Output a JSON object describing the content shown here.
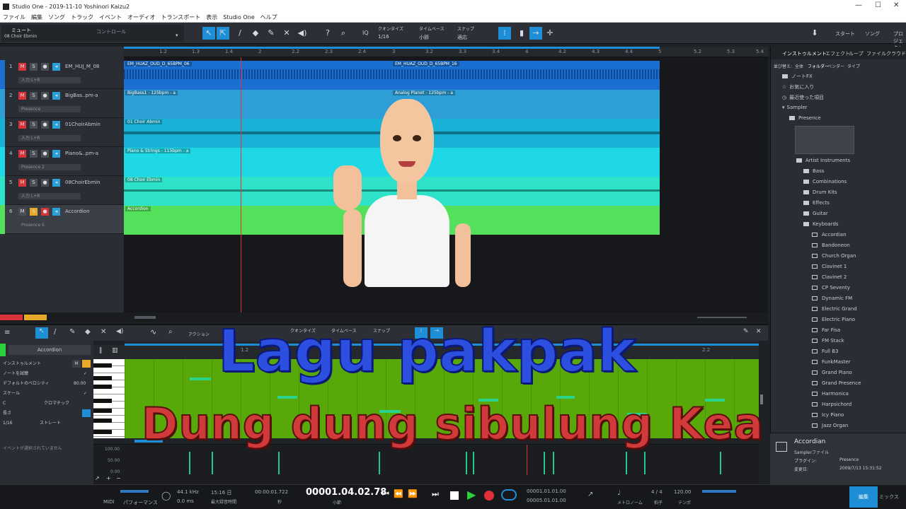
{
  "window": {
    "title": "Studio One - 2019-11-10 Yoshinori Kaizu2"
  },
  "menu": [
    "ファイル",
    "編集",
    "ソング",
    "トラック",
    "イベント",
    "オーディオ",
    "トランスポート",
    "表示",
    "Studio One",
    "ヘルプ"
  ],
  "toolbar": {
    "mute_label": "ミュート",
    "track_label": "08 Choir Ebmin",
    "control_label": "コントロール",
    "quantize_label": "クオンタイズ",
    "quantize_value": "1/16",
    "timebase_label": "タイムベース",
    "timebase_value": "小節",
    "snap_label": "スナップ",
    "snap_value": "適応",
    "iq": "IQ",
    "start_label": "スタート",
    "song_label": "ソング",
    "project_label": "プロジェクト"
  },
  "ruler_ticks": [
    "1.2",
    "1.3",
    "1.4",
    "2",
    "2.2",
    "2.3",
    "2.4",
    "3",
    "3.2",
    "3.3",
    "3.4",
    "4",
    "4.2",
    "4.3",
    "4.4",
    "5",
    "5.2",
    "5.3",
    "5.4"
  ],
  "tracks": [
    {
      "num": "1",
      "name": "EM_HUJ_M_08",
      "sub": "入力 L+R",
      "color": "#1a6fd0",
      "clip_a": "EM_HUAZ_OUD_D_65BPM_06",
      "clip_b": "EM_HUAZ_OUD_D_65BPM_16"
    },
    {
      "num": "2",
      "name": "BigBas..pm-a",
      "sub": "Presence",
      "color": "#2d9ed6",
      "clip_a": "BigBass1 - 125bpm - a",
      "clip_b": "Analog Planet - 125bpm - a"
    },
    {
      "num": "3",
      "name": "01ChoirAbmin",
      "sub": "入力 L+R",
      "color": "#19b2d6",
      "clip_a": "01 Choir Abmin",
      "clip_b": ""
    },
    {
      "num": "4",
      "name": "Piano&..pm-a",
      "sub": "Presence 2",
      "color": "#1fd8e6",
      "clip_a": "Piano & Strings - 115bpm - a",
      "clip_b": ""
    },
    {
      "num": "5",
      "name": "08ChoirEbmin",
      "sub": "入力 L+R",
      "color": "#2de2c8",
      "clip_a": "08 Choir Ebmin",
      "clip_b": ""
    },
    {
      "num": "6",
      "name": "Accordion",
      "sub": "Presence 6",
      "color": "#53e05a",
      "clip_a": "Accordion",
      "clip_b": ""
    }
  ],
  "browser": {
    "tabs": [
      "インストゥルメント",
      "エフェクト",
      "ループ",
      "ファイル",
      "クラウド"
    ],
    "subtabs": [
      "並び替え:",
      "全体",
      "フォルダー",
      "ベンダー",
      "タイプ"
    ],
    "items": [
      {
        "label": "ノートFX",
        "level": 1
      },
      {
        "label": "お気に入り",
        "level": 1
      },
      {
        "label": "最近使った項目",
        "level": 1
      },
      {
        "label": "Sampler",
        "level": 1
      },
      {
        "label": "Presence",
        "level": 2
      },
      {
        "label": "Artist Instruments",
        "level": 3
      },
      {
        "label": "Bass",
        "level": 4
      },
      {
        "label": "Combinations",
        "level": 4
      },
      {
        "label": "Drum Kits",
        "level": 4
      },
      {
        "label": "Effects",
        "level": 4
      },
      {
        "label": "Guitar",
        "level": 4
      },
      {
        "label": "Keyboards",
        "level": 4
      }
    ],
    "presets": [
      "Accordian",
      "Bandoneon",
      "Church Organ",
      "Clavinet 1",
      "Clavinet 2",
      "CP Seventy",
      "Dynamic FM",
      "Electric Grand",
      "Electric Piano",
      "Far Fisa",
      "FM Stack",
      "Full B3",
      "FunkMaster",
      "Grand Piano",
      "Grand Presence",
      "Harmonica",
      "Harpsichord",
      "Icy Piano",
      "Jazz Organ"
    ]
  },
  "info": {
    "name": "Accordian",
    "type": "Samplerファイル",
    "plugin_label": "プラグイン:",
    "plugin": "Presence",
    "date_label": "変更日:",
    "date": "2009/7/13 15:31:52"
  },
  "editor": {
    "action_label": "アクション",
    "quantize_label": "クオンタイズ",
    "timebase_label": "タイムベース",
    "snap_label": "スナップ",
    "instrument": "Accordion",
    "rows": [
      "インストゥルメント",
      "ノートを試聴",
      "デフォルトのベロシティ",
      "スケール",
      "長さ",
      "イベントが選択されていません"
    ],
    "velocity": "80.00",
    "scale_key": "C",
    "scale_type": "クロマチック",
    "length": "1/16",
    "length_mode": "ストレート",
    "ruler": [
      "1.2",
      "2.2"
    ],
    "vel_scale": [
      "100.00",
      "50.00",
      "0.00"
    ]
  },
  "transport": {
    "midi": "MIDI",
    "perf": "パフォーマンス",
    "sample_rate": "44.1 kHz",
    "latency": "0.0 ms",
    "time": "15:16 日",
    "rec_max": "最大録音時間",
    "seconds": "00:00:01.722",
    "sec_label": "秒",
    "position": "00001.04.02.78",
    "bar_label": "小節",
    "loop_l": "00001.01.01.00",
    "loop_r": "00005.01.01.00",
    "metronome": "メトロノーム",
    "sig": "4 / 4",
    "sig_label": "拍子",
    "tempo": "120.00",
    "tempo_label": "テンポ",
    "edit": "編集",
    "mix": "ミックス"
  },
  "overlay": {
    "line1": "Lagu pakpak",
    "line2": "Dung dung sibulung Kea"
  },
  "colors": {
    "accent": "#1e8fd6",
    "record": "#e0303a",
    "play": "#2bd13a"
  }
}
